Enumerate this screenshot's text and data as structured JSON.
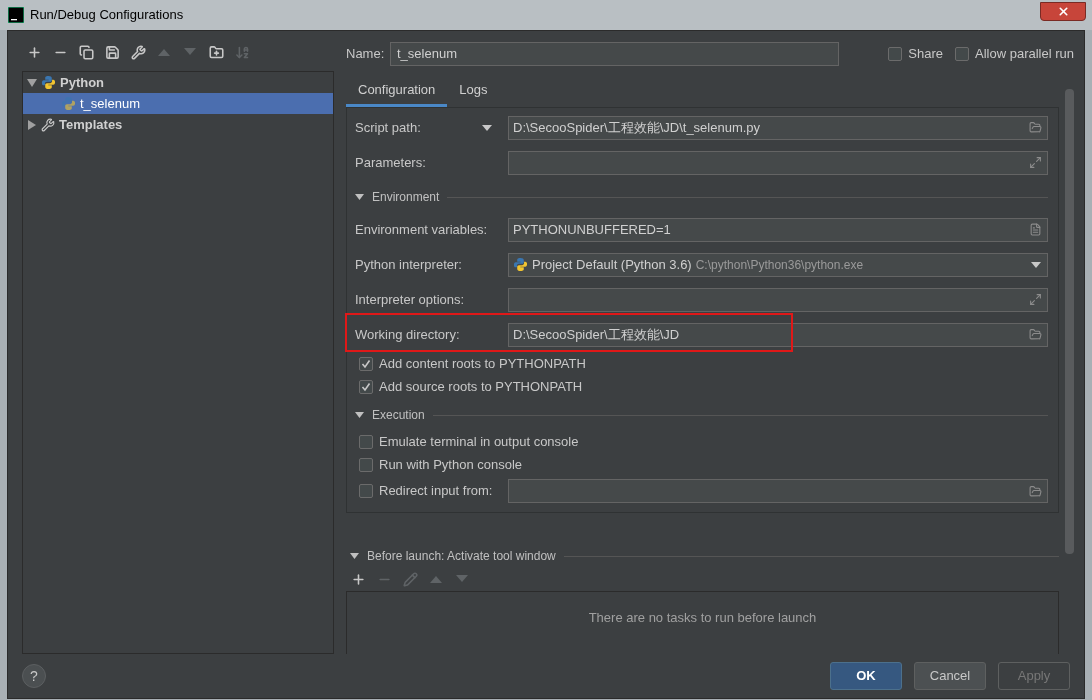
{
  "window": {
    "title": "Run/Debug Configurations"
  },
  "toolbar": [
    {
      "kind": "add",
      "disabled": false
    },
    {
      "kind": "remove",
      "disabled": false
    },
    {
      "kind": "copy",
      "disabled": false
    },
    {
      "kind": "save",
      "disabled": false
    },
    {
      "kind": "wrench",
      "disabled": false
    },
    {
      "kind": "up",
      "disabled": true
    },
    {
      "kind": "down",
      "disabled": true
    },
    {
      "kind": "folder",
      "disabled": false
    },
    {
      "kind": "sort",
      "disabled": true
    }
  ],
  "tree": [
    {
      "label": "Python",
      "kind": "python",
      "expanded": true,
      "selected": false,
      "children": [
        {
          "label": "t_selenum",
          "kind": "python",
          "selected": true
        }
      ]
    },
    {
      "label": "Templates",
      "kind": "wrench",
      "expanded": false,
      "selected": false
    }
  ],
  "name_field": {
    "label": "Name:",
    "value": "t_selenum"
  },
  "options": [
    {
      "label": "Share",
      "checked": false
    },
    {
      "label": "Allow parallel run",
      "checked": false
    }
  ],
  "tabs": [
    {
      "label": "Configuration",
      "selected": true
    },
    {
      "label": "Logs",
      "selected": false
    }
  ],
  "rows": [
    {
      "kind": "field",
      "label": "Script path:",
      "label_dropdown": true,
      "value": "D:\\SecooSpider\\工程效能\\JD\\t_selenum.py",
      "button": {
        "kind": "folder"
      }
    },
    {
      "kind": "field",
      "label": "Parameters:",
      "button": {
        "kind": "expand"
      }
    },
    {
      "kind": "section",
      "label": "Environment",
      "expanded": true
    },
    {
      "kind": "field",
      "label": "Environment variables:",
      "value": "PYTHONUNBUFFERED=1",
      "button": {
        "kind": "list"
      }
    },
    {
      "kind": "interpreter",
      "label": "Python interpreter:",
      "value": "Project Default (Python 3.6)",
      "hint": "C:\\python\\Python36\\python.exe",
      "button": {
        "kind": "dropdown"
      }
    },
    {
      "kind": "field",
      "label": "Interpreter options:",
      "button": {
        "kind": "expand"
      }
    },
    {
      "kind": "field",
      "label": "Working directory:",
      "value": "D:\\SecooSpider\\工程效能\\JD",
      "button": {
        "kind": "folder"
      },
      "highlighted": true
    },
    {
      "kind": "checkbox",
      "label": "Add content roots to PYTHONPATH",
      "checked": true
    },
    {
      "kind": "checkbox",
      "label": "Add source roots to PYTHONPATH",
      "checked": true
    },
    {
      "kind": "section",
      "label": "Execution",
      "expanded": true
    },
    {
      "kind": "checkbox",
      "label": "Emulate terminal in output console",
      "checked": false
    },
    {
      "kind": "checkbox",
      "label": "Run with Python console",
      "checked": false
    },
    {
      "kind": "checkbox_field",
      "label": "Redirect input from:",
      "checked": false,
      "button": {
        "kind": "folder"
      }
    }
  ],
  "before_launch": {
    "title": "Before launch: Activate tool window",
    "expanded": true,
    "toolbar": [
      {
        "kind": "add",
        "disabled": false
      },
      {
        "kind": "remove",
        "disabled": true
      },
      {
        "kind": "edit",
        "disabled": true
      },
      {
        "kind": "up",
        "disabled": true
      },
      {
        "kind": "down",
        "disabled": true
      }
    ],
    "empty_text": "There are no tasks to run before launch"
  },
  "help": "?",
  "buttons": [
    {
      "label": "OK",
      "kind": "primary",
      "disabled": false
    },
    {
      "label": "Cancel",
      "kind": "normal",
      "disabled": false
    },
    {
      "label": "Apply",
      "kind": "normal",
      "disabled": true
    }
  ]
}
